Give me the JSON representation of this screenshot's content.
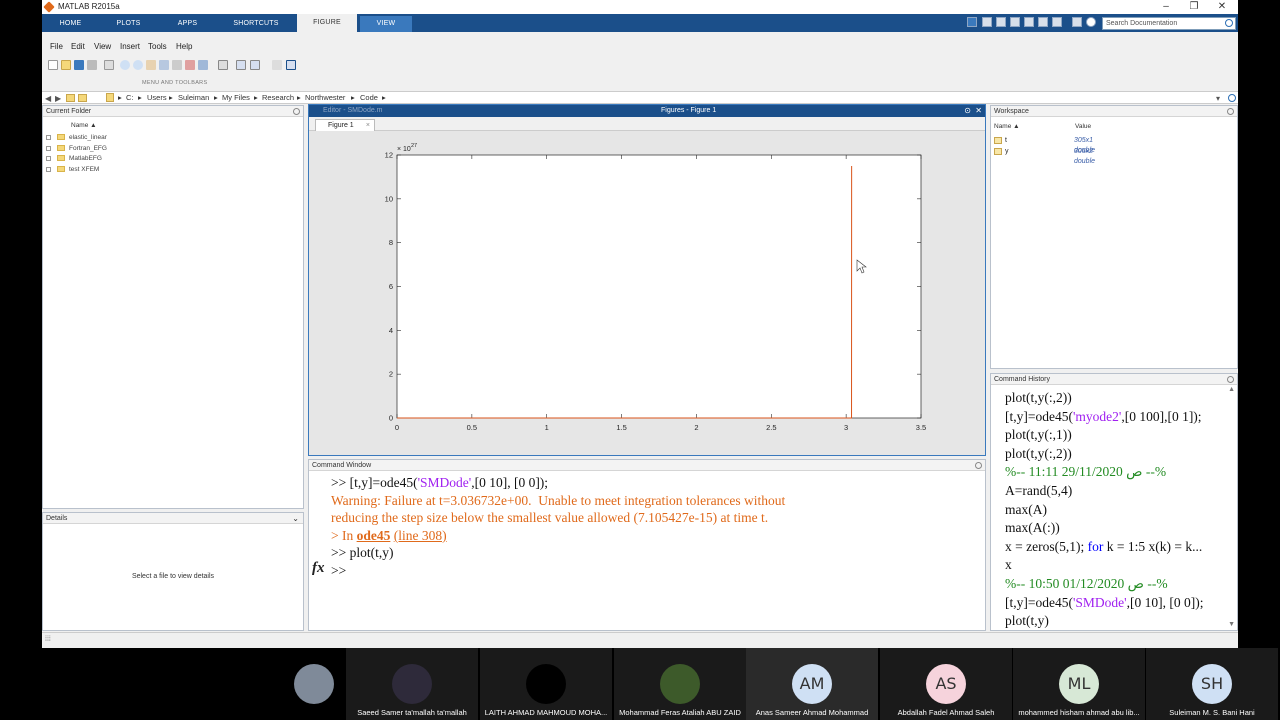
{
  "window": {
    "title": "MATLAB R2015a",
    "controls": [
      "–",
      "❐",
      "✕"
    ]
  },
  "ribbon": {
    "tabs": [
      "HOME",
      "PLOTS",
      "APPS",
      "SHORTCUTS",
      "FIGURE",
      "VIEW"
    ],
    "active_tab": "FIGURE",
    "search_placeholder": "Search Documentation",
    "toolbar_label": "MENU AND TOOLBARS"
  },
  "menu": [
    "File",
    "Edit",
    "View",
    "Insert",
    "Tools",
    "Help"
  ],
  "address": {
    "crumbs": [
      "C:",
      "Users",
      "Suleiman",
      "My Files",
      "Research",
      "Northwester",
      "Code"
    ]
  },
  "current_folder": {
    "title": "Current Folder",
    "column": "Name ▲",
    "items": [
      "elastic_linear",
      "Fortran_EFG",
      "MatlabEFG",
      "test XFEM"
    ]
  },
  "details": {
    "title": "Details",
    "message": "Select a file to view details"
  },
  "figure_window": {
    "editor_tab": "Editor - SMDode.m",
    "title": "Figures - Figure 1",
    "tab": "Figure 1"
  },
  "chart_data": {
    "type": "line",
    "title": "",
    "xlabel": "",
    "ylabel": "",
    "exponent_label": "× 10",
    "exponent_power": "27",
    "xlim": [
      0,
      3.5
    ],
    "ylim": [
      0,
      12
    ],
    "x_ticks": [
      "0",
      "0.5",
      "1",
      "1.5",
      "2",
      "2.5",
      "3",
      "3.5"
    ],
    "y_ticks": [
      "0",
      "2",
      "4",
      "6",
      "8",
      "10",
      "12"
    ],
    "series": [
      {
        "color": "#0072bd",
        "x": [
          0,
          3.036
        ],
        "y": [
          0,
          0
        ]
      },
      {
        "color": "#d95319",
        "x": [
          0,
          3.0,
          3.03,
          3.036,
          3.0367
        ],
        "y": [
          0,
          0,
          0,
          0,
          11.5
        ]
      }
    ]
  },
  "command_window": {
    "title": "Command Window",
    "lines": [
      {
        "text": ">> [t,y]=ode45(",
        "str": "'SMDode'",
        "rest": ",[0 10], [0 0]);"
      },
      {
        "warn": "Warning: Failure at t=3.036732e+00.  Unable to meet integration tolerances without"
      },
      {
        "warn": "reducing the step size below the smallest value allowed (7.105427e-15) at time t."
      },
      {
        "link_prefix": "> In ",
        "link1": "ode45",
        "link2": "(line 308)"
      },
      {
        "text": ">> plot(t,y)"
      },
      {
        "text": ">> "
      }
    ]
  },
  "workspace": {
    "title": "Workspace",
    "columns": [
      "Name ▲",
      "Value"
    ],
    "vars": [
      {
        "name": "t",
        "value": "305x1 double"
      },
      {
        "name": "y",
        "value": "305x2 double"
      }
    ]
  },
  "history": {
    "title": "Command History",
    "lines": [
      {
        "a": "plot(t,y(:,2))"
      },
      {
        "a": "[t,y]=ode45(",
        "s": "'myode2'",
        "b": ",[0 100],[0 1]);"
      },
      {
        "a": "plot(t,y(:,1))"
      },
      {
        "a": "plot(t,y(:,2))"
      },
      {
        "c": "%-- 11:11 29/11/2020 ص --%"
      },
      {
        "a": "A=rand(5,4)"
      },
      {
        "a": "max(A)"
      },
      {
        "a": "max(A(:))"
      },
      {
        "a": "x = zeros(5,1); ",
        "k": "for",
        "b": " k = 1:5 x(k) = k..."
      },
      {
        "a": "x"
      },
      {
        "c": "%-- 10:50 01/12/2020 ص --%"
      },
      {
        "a": "[t,y]=ode45(",
        "s": "'SMDode'",
        "b": ",[0 10], [0 0]);"
      },
      {
        "a": "plot(t,y)"
      }
    ]
  },
  "participants": [
    {
      "initials": "",
      "name": "",
      "color": "#7f8a99"
    },
    {
      "initials": "",
      "name": "Saeed Samer ta'mallah ta'mallah",
      "color": "#2e2a3a"
    },
    {
      "initials": "",
      "name": "LAITH  AHMAD  MAHMOUD MOHA...",
      "color": "#000000"
    },
    {
      "initials": "",
      "name": "Mohammad Feras Ataliah ABU ZAID",
      "color": "#3d5a2a"
    },
    {
      "initials": "AM",
      "name": "Anas Sameer Ahmad Mohammad",
      "color": "#cfe0f4"
    },
    {
      "initials": "AS",
      "name": "Abdallah Fadel Ahmad Saleh",
      "color": "#f6d3dc"
    },
    {
      "initials": "ML",
      "name": "mohammed hisham ahmad abu lib...",
      "color": "#d7e8d6"
    },
    {
      "initials": "SH",
      "name": "Suleiman M. S. Bani Hani",
      "color": "#cfe0f4"
    }
  ]
}
